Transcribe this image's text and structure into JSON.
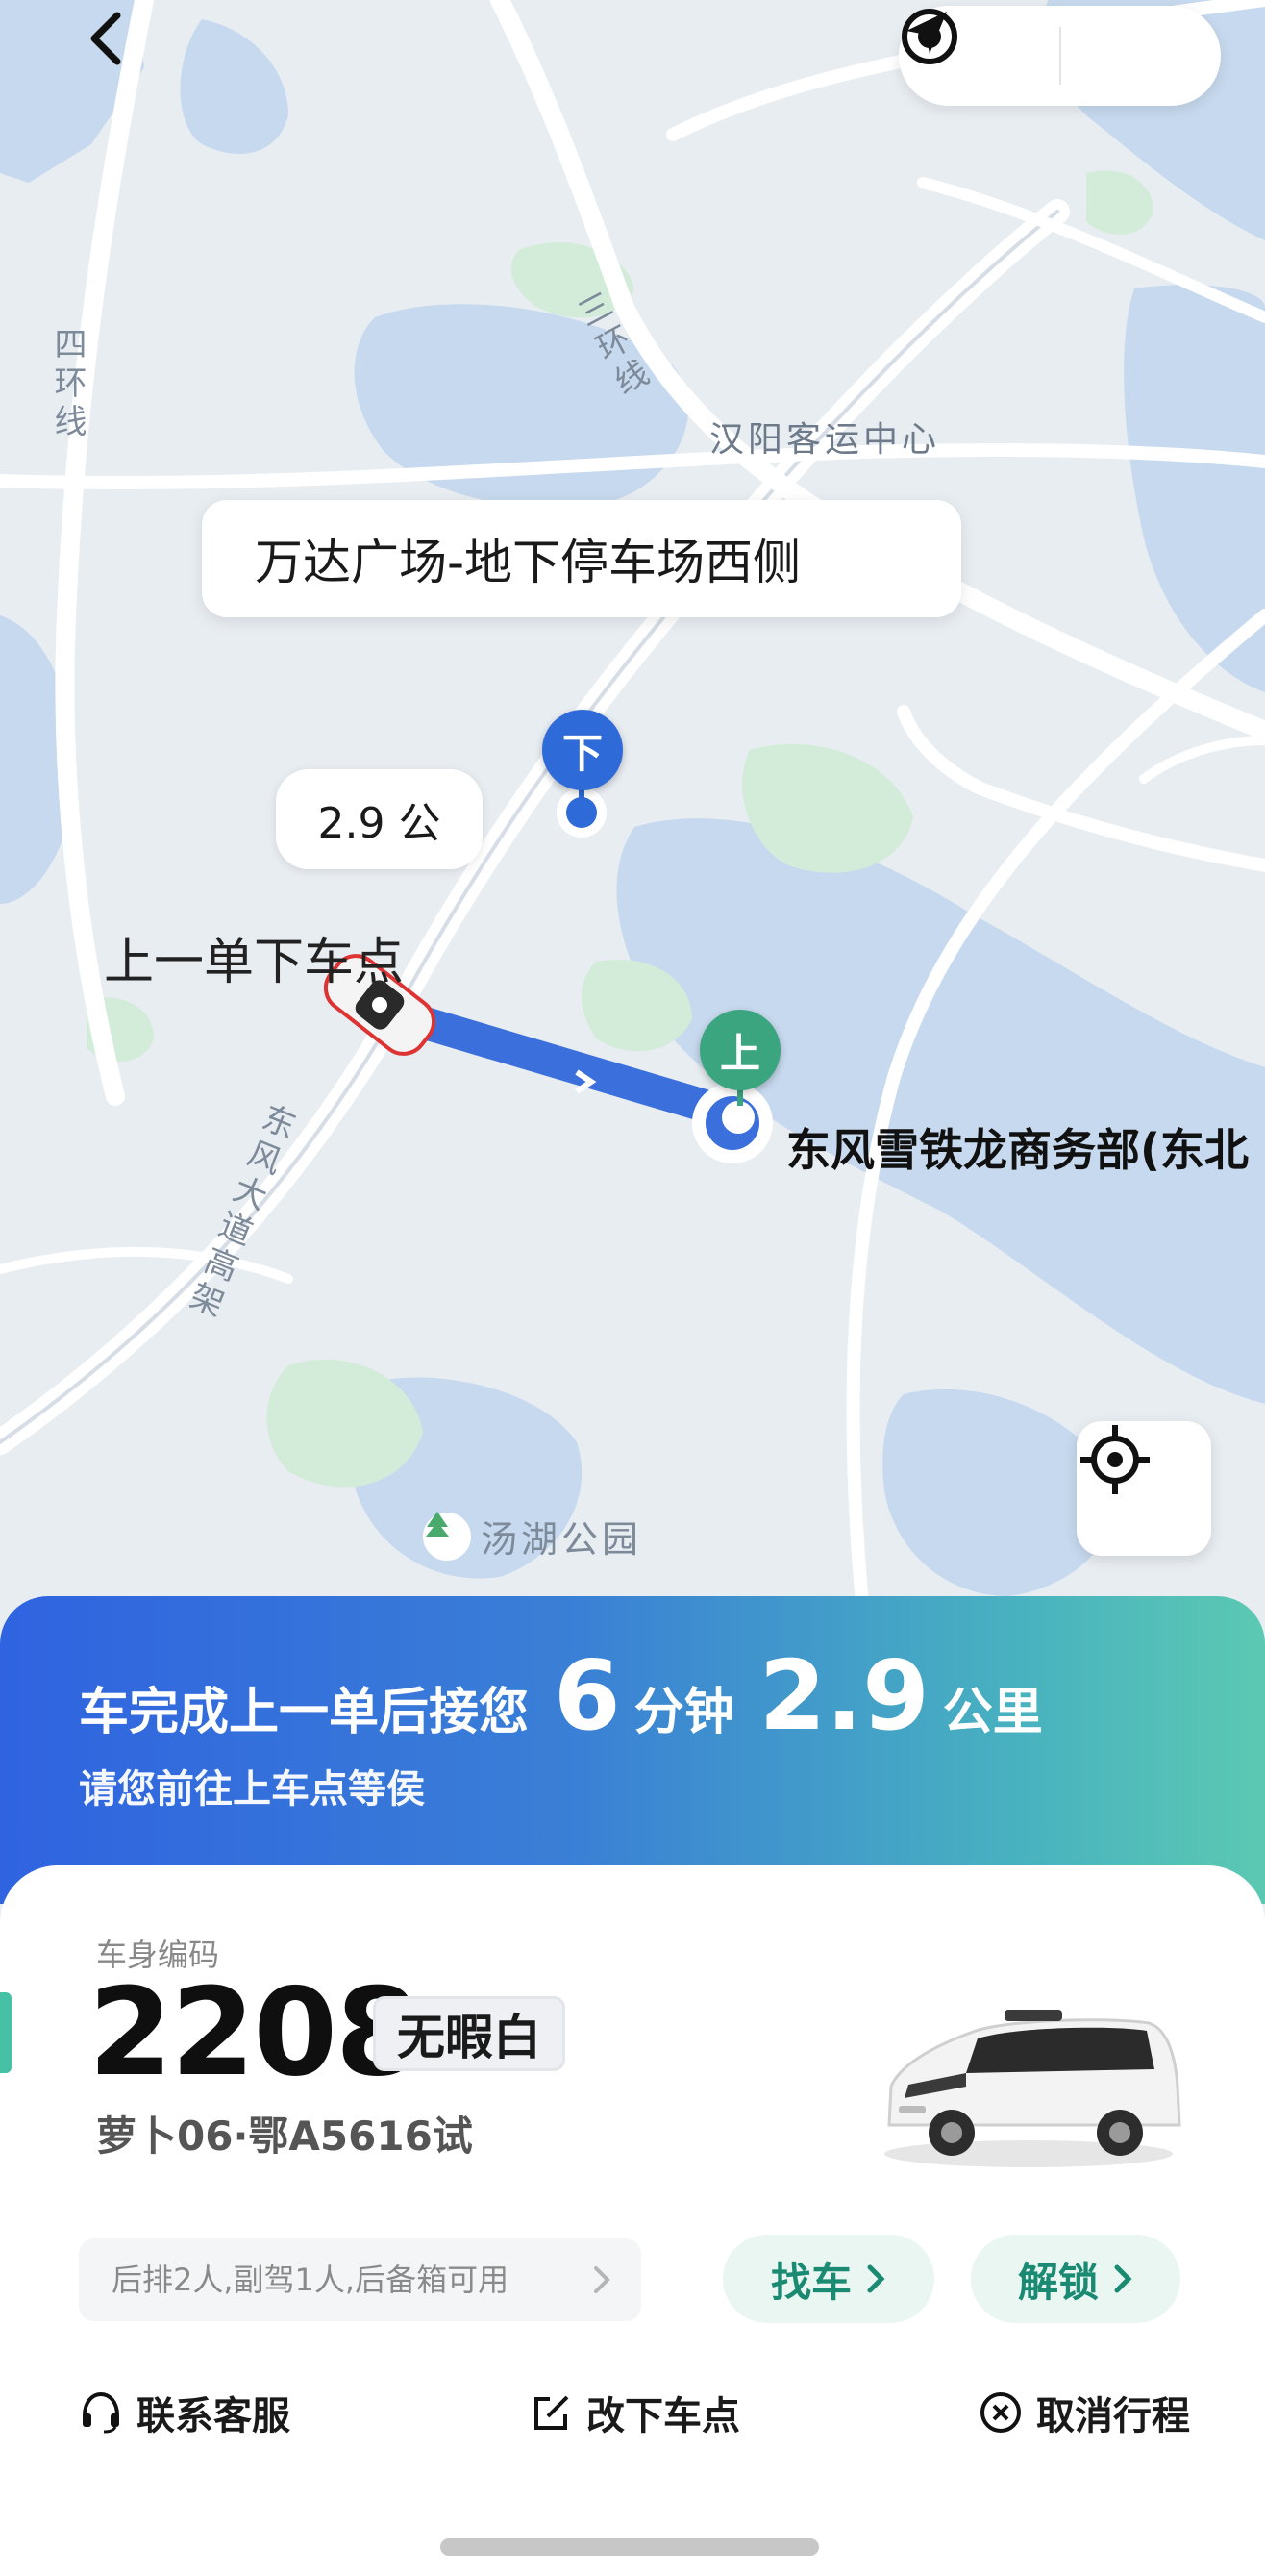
{
  "map": {
    "destination_label": "万达广场-地下停车场西侧",
    "distance_bubble": "2.9 公",
    "previous_dropoff_label": "上一单下车点",
    "pickup_location_label": "东风雪铁龙商务部(东北",
    "dropoff_pin": "下",
    "pickup_pin": "上",
    "roads": {
      "fourth_ring": "四环线",
      "third_ring": "三环线",
      "dongfeng_avenue": "东风大道高架"
    },
    "station": "汉阳客运中心",
    "park": "汤湖公园",
    "colors": {
      "route": "#3b6fdc",
      "dropoff_pin": "#2e6ad8",
      "pickup_pin": "#3aa57e",
      "water": "#c7d9ee",
      "green": "#d3ecd9"
    }
  },
  "eta": {
    "prefix": "车完成上一单后接您",
    "minutes": "6",
    "minutes_unit": "分钟",
    "distance": "2.9",
    "distance_unit": "公里",
    "subtitle": "请您前往上车点等侯"
  },
  "vehicle": {
    "body_code_label": "车身编码",
    "number": "2208",
    "name": "无暇白",
    "plate": "萝卜06·鄂A5616试"
  },
  "seat_info": "后排2人,副驾1人,后备箱可用",
  "buttons": {
    "find_car": "找车",
    "unlock": "解锁"
  },
  "actions": {
    "support": "联系客服",
    "change_dropoff": "改下车点",
    "cancel_trip": "取消行程"
  }
}
